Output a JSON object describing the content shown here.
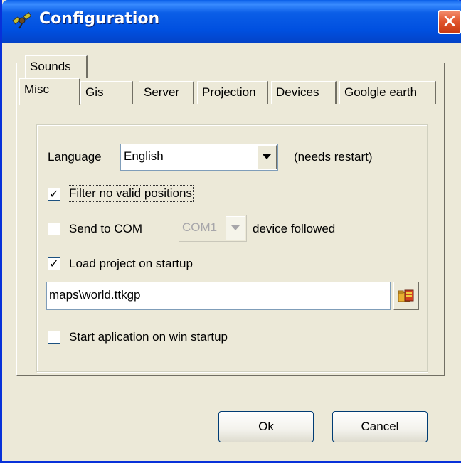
{
  "window": {
    "title": "Configuration",
    "close_symbol": "✕"
  },
  "tabs": {
    "row1": [
      "Sounds"
    ],
    "row2": [
      "Misc",
      "Gis",
      "Server",
      "Projection",
      "Devices",
      "Goolgle earth"
    ],
    "active": "Misc"
  },
  "misc": {
    "language_label": "Language",
    "language_value": "English",
    "language_note": "(needs restart)",
    "filter_label": "Filter no valid positions",
    "filter_checked": true,
    "send_com_label": "Send to COM",
    "send_com_checked": false,
    "com_port_value": "COM1",
    "device_followed_label": "device followed",
    "load_project_label": "Load project on startup",
    "load_project_checked": true,
    "project_path": "maps\\world.ttkgp",
    "start_app_label": "Start aplication on win startup",
    "start_app_checked": false
  },
  "buttons": {
    "ok": "Ok",
    "cancel": "Cancel"
  },
  "icons": {
    "app": "satellite-icon",
    "browse": "folder-icon",
    "dropdown": "chevron-down-icon",
    "check": "checkmark-icon"
  },
  "colors": {
    "titlebar": "#0054e3",
    "close": "#e2562e",
    "face": "#ece9d8"
  }
}
